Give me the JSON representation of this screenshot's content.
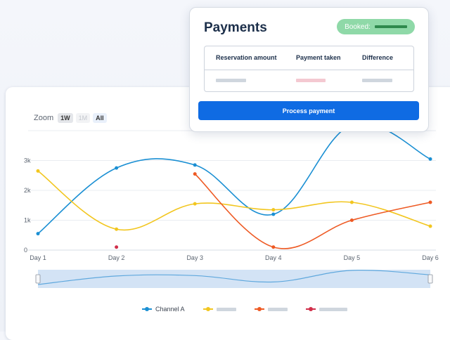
{
  "zoom": {
    "label": "Zoom",
    "options": [
      "1W",
      "1M",
      "All"
    ],
    "active": "1W",
    "disabled": [
      "1M"
    ]
  },
  "popup": {
    "title": "Payments",
    "badge_label": "Booked:",
    "columns": [
      "Reservation amount",
      "Payment taken",
      "Difference"
    ],
    "button_label": "Process payment"
  },
  "legend": {
    "first_series": "Channel A"
  },
  "colors": {
    "channel_a": "#1a8fd3",
    "series_b": "#f2c61f",
    "series_c": "#ee5a24",
    "series_d": "#d12f4a",
    "accent": "#0f6be3",
    "badge": "#8fd9a8"
  },
  "chart_data": {
    "type": "line",
    "categories": [
      "Day 1",
      "Day 2",
      "Day 3",
      "Day 4",
      "Day 5",
      "Day 6"
    ],
    "ytick_labels": [
      "0",
      "1k",
      "2k",
      "3k"
    ],
    "ylim": [
      0,
      4000
    ],
    "grid": true,
    "series": [
      {
        "name": "Channel A",
        "values": [
          550,
          2750,
          2850,
          1200,
          4200,
          3050
        ]
      },
      {
        "values": [
          2650,
          700,
          1550,
          1350,
          1600,
          800
        ]
      },
      {
        "values": [
          null,
          null,
          2550,
          100,
          1000,
          1600
        ]
      },
      {
        "values": [
          null,
          100,
          null,
          null,
          null,
          null
        ]
      }
    ]
  }
}
